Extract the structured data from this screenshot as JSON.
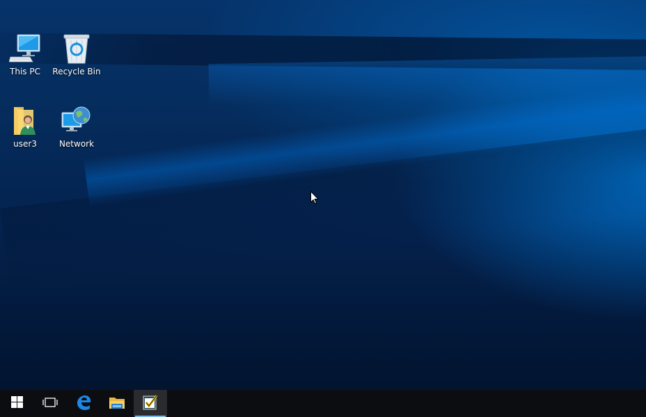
{
  "desktop": {
    "icons": [
      {
        "label": "This PC",
        "icon": "computer-icon"
      },
      {
        "label": "Recycle Bin",
        "icon": "recycle-bin-icon"
      },
      {
        "label": "user3",
        "icon": "user-folder-icon"
      },
      {
        "label": "Network",
        "icon": "network-icon"
      }
    ]
  },
  "taskbar": {
    "items": [
      {
        "icon": "windows-start-icon",
        "active": false
      },
      {
        "icon": "task-view-icon",
        "active": false
      },
      {
        "icon": "edge-browser-icon",
        "active": false
      },
      {
        "icon": "file-explorer-icon",
        "active": false
      },
      {
        "icon": "task-checklist-app-icon",
        "active": true
      }
    ]
  },
  "colors": {
    "accent": "#0078d7",
    "taskbar": "#0c0d10",
    "active_indicator": "#76b9ed"
  }
}
